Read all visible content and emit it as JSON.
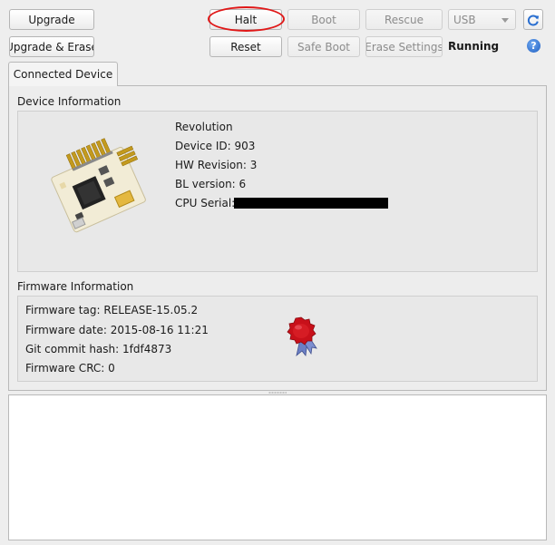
{
  "toolbar": {
    "upgrade": "Upgrade",
    "upgrade_erase": "Upgrade & Erase",
    "halt": "Halt",
    "reset": "Reset",
    "boot": "Boot",
    "safe_boot": "Safe Boot",
    "rescue": "Rescue",
    "erase_settings": "Erase Settings",
    "port_select": "USB",
    "refresh_icon": "refresh-icon",
    "status": "Running",
    "help_glyph": "?",
    "help_icon": "help-icon"
  },
  "tabs": [
    {
      "label": "Connected Device"
    }
  ],
  "device_info": {
    "title": "Device Information",
    "board": "Revolution",
    "device_id": "Device ID: 903",
    "hw_revision": "HW Revision: 3",
    "bl_version": "BL version: 6",
    "cpu_serial_label": "CPU Serial:"
  },
  "firmware_info": {
    "title": "Firmware Information",
    "tag": "Firmware tag: RELEASE-15.05.2",
    "date": "Firmware date: 2015-08-16 11:21",
    "git_hash": "Git commit hash: 1fdf4873",
    "crc": "Firmware CRC: 0",
    "seal_icon": "certified-seal-icon"
  },
  "colors": {
    "annotation_ring": "#e01818",
    "seal_red": "#c8101a",
    "ribbon_blue": "#6b7fc4"
  }
}
